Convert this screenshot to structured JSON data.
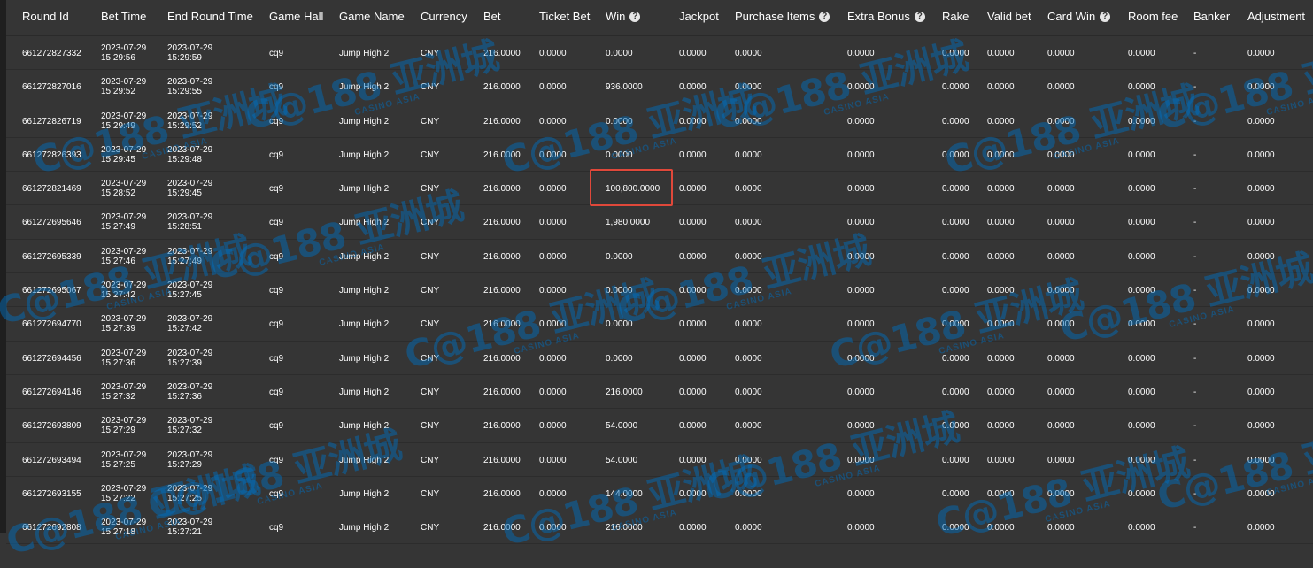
{
  "columns": [
    {
      "label": "Round Id",
      "help": ""
    },
    {
      "label": "Bet Time",
      "help": ""
    },
    {
      "label": "End Round Time",
      "help": ""
    },
    {
      "label": "Game Hall",
      "help": ""
    },
    {
      "label": "Game Name",
      "help": ""
    },
    {
      "label": "Currency",
      "help": ""
    },
    {
      "label": "Bet",
      "help": ""
    },
    {
      "label": "Ticket Bet",
      "help": ""
    },
    {
      "label": "Win",
      "help": "?"
    },
    {
      "label": "Jackpot",
      "help": ""
    },
    {
      "label": "Purchase Items",
      "help": "?"
    },
    {
      "label": "Extra Bonus",
      "help": "?"
    },
    {
      "label": "Rake",
      "help": ""
    },
    {
      "label": "Valid bet",
      "help": ""
    },
    {
      "label": "Card Win",
      "help": "?"
    },
    {
      "label": "Room fee",
      "help": ""
    },
    {
      "label": "Banker",
      "help": ""
    },
    {
      "label": "Adjustment",
      "help": ""
    }
  ],
  "rows": [
    {
      "round_id": "661272827332",
      "bet_date": "2023-07-29",
      "bet_time": "15:29:56",
      "end_date": "2023-07-29",
      "end_time": "15:29:59",
      "hall": "cq9",
      "game": "Jump High 2",
      "currency": "CNY",
      "bet": "216.0000",
      "ticket_bet": "0.0000",
      "win": "0.0000",
      "jackpot": "0.0000",
      "purchase": "0.0000",
      "extra": "0.0000",
      "rake": "0.0000",
      "valid": "0.0000",
      "card_win": "0.0000",
      "room_fee": "0.0000",
      "banker": "-",
      "adjustment": "0.0000"
    },
    {
      "round_id": "661272827016",
      "bet_date": "2023-07-29",
      "bet_time": "15:29:52",
      "end_date": "2023-07-29",
      "end_time": "15:29:55",
      "hall": "cq9",
      "game": "Jump High 2",
      "currency": "CNY",
      "bet": "216.0000",
      "ticket_bet": "0.0000",
      "win": "936.0000",
      "jackpot": "0.0000",
      "purchase": "0.0000",
      "extra": "0.0000",
      "rake": "0.0000",
      "valid": "0.0000",
      "card_win": "0.0000",
      "room_fee": "0.0000",
      "banker": "-",
      "adjustment": "0.0000"
    },
    {
      "round_id": "661272826719",
      "bet_date": "2023-07-29",
      "bet_time": "15:29:49",
      "end_date": "2023-07-29",
      "end_time": "15:29:52",
      "hall": "cq9",
      "game": "Jump High 2",
      "currency": "CNY",
      "bet": "216.0000",
      "ticket_bet": "0.0000",
      "win": "0.0000",
      "jackpot": "0.0000",
      "purchase": "0.0000",
      "extra": "0.0000",
      "rake": "0.0000",
      "valid": "0.0000",
      "card_win": "0.0000",
      "room_fee": "0.0000",
      "banker": "-",
      "adjustment": "0.0000"
    },
    {
      "round_id": "661272826393",
      "bet_date": "2023-07-29",
      "bet_time": "15:29:45",
      "end_date": "2023-07-29",
      "end_time": "15:29:48",
      "hall": "cq9",
      "game": "Jump High 2",
      "currency": "CNY",
      "bet": "216.0000",
      "ticket_bet": "0.0000",
      "win": "0.0000",
      "jackpot": "0.0000",
      "purchase": "0.0000",
      "extra": "0.0000",
      "rake": "0.0000",
      "valid": "0.0000",
      "card_win": "0.0000",
      "room_fee": "0.0000",
      "banker": "-",
      "adjustment": "0.0000"
    },
    {
      "round_id": "661272821469",
      "bet_date": "2023-07-29",
      "bet_time": "15:28:52",
      "end_date": "2023-07-29",
      "end_time": "15:29:45",
      "hall": "cq9",
      "game": "Jump High 2",
      "currency": "CNY",
      "bet": "216.0000",
      "ticket_bet": "0.0000",
      "win": "100,800.0000",
      "jackpot": "0.0000",
      "purchase": "0.0000",
      "extra": "0.0000",
      "rake": "0.0000",
      "valid": "0.0000",
      "card_win": "0.0000",
      "room_fee": "0.0000",
      "banker": "-",
      "adjustment": "0.0000"
    },
    {
      "round_id": "661272695646",
      "bet_date": "2023-07-29",
      "bet_time": "15:27:49",
      "end_date": "2023-07-29",
      "end_time": "15:28:51",
      "hall": "cq9",
      "game": "Jump High 2",
      "currency": "CNY",
      "bet": "216.0000",
      "ticket_bet": "0.0000",
      "win": "1,980.0000",
      "jackpot": "0.0000",
      "purchase": "0.0000",
      "extra": "0.0000",
      "rake": "0.0000",
      "valid": "0.0000",
      "card_win": "0.0000",
      "room_fee": "0.0000",
      "banker": "-",
      "adjustment": "0.0000"
    },
    {
      "round_id": "661272695339",
      "bet_date": "2023-07-29",
      "bet_time": "15:27:46",
      "end_date": "2023-07-29",
      "end_time": "15:27:49",
      "hall": "cq9",
      "game": "Jump High 2",
      "currency": "CNY",
      "bet": "216.0000",
      "ticket_bet": "0.0000",
      "win": "0.0000",
      "jackpot": "0.0000",
      "purchase": "0.0000",
      "extra": "0.0000",
      "rake": "0.0000",
      "valid": "0.0000",
      "card_win": "0.0000",
      "room_fee": "0.0000",
      "banker": "-",
      "adjustment": "0.0000"
    },
    {
      "round_id": "661272695067",
      "bet_date": "2023-07-29",
      "bet_time": "15:27:42",
      "end_date": "2023-07-29",
      "end_time": "15:27:45",
      "hall": "cq9",
      "game": "Jump High 2",
      "currency": "CNY",
      "bet": "216.0000",
      "ticket_bet": "0.0000",
      "win": "0.0000",
      "jackpot": "0.0000",
      "purchase": "0.0000",
      "extra": "0.0000",
      "rake": "0.0000",
      "valid": "0.0000",
      "card_win": "0.0000",
      "room_fee": "0.0000",
      "banker": "-",
      "adjustment": "0.0000"
    },
    {
      "round_id": "661272694770",
      "bet_date": "2023-07-29",
      "bet_time": "15:27:39",
      "end_date": "2023-07-29",
      "end_time": "15:27:42",
      "hall": "cq9",
      "game": "Jump High 2",
      "currency": "CNY",
      "bet": "216.0000",
      "ticket_bet": "0.0000",
      "win": "0.0000",
      "jackpot": "0.0000",
      "purchase": "0.0000",
      "extra": "0.0000",
      "rake": "0.0000",
      "valid": "0.0000",
      "card_win": "0.0000",
      "room_fee": "0.0000",
      "banker": "-",
      "adjustment": "0.0000"
    },
    {
      "round_id": "661272694456",
      "bet_date": "2023-07-29",
      "bet_time": "15:27:36",
      "end_date": "2023-07-29",
      "end_time": "15:27:39",
      "hall": "cq9",
      "game": "Jump High 2",
      "currency": "CNY",
      "bet": "216.0000",
      "ticket_bet": "0.0000",
      "win": "0.0000",
      "jackpot": "0.0000",
      "purchase": "0.0000",
      "extra": "0.0000",
      "rake": "0.0000",
      "valid": "0.0000",
      "card_win": "0.0000",
      "room_fee": "0.0000",
      "banker": "-",
      "adjustment": "0.0000"
    },
    {
      "round_id": "661272694146",
      "bet_date": "2023-07-29",
      "bet_time": "15:27:32",
      "end_date": "2023-07-29",
      "end_time": "15:27:36",
      "hall": "cq9",
      "game": "Jump High 2",
      "currency": "CNY",
      "bet": "216.0000",
      "ticket_bet": "0.0000",
      "win": "216.0000",
      "jackpot": "0.0000",
      "purchase": "0.0000",
      "extra": "0.0000",
      "rake": "0.0000",
      "valid": "0.0000",
      "card_win": "0.0000",
      "room_fee": "0.0000",
      "banker": "-",
      "adjustment": "0.0000"
    },
    {
      "round_id": "661272693809",
      "bet_date": "2023-07-29",
      "bet_time": "15:27:29",
      "end_date": "2023-07-29",
      "end_time": "15:27:32",
      "hall": "cq9",
      "game": "Jump High 2",
      "currency": "CNY",
      "bet": "216.0000",
      "ticket_bet": "0.0000",
      "win": "54.0000",
      "jackpot": "0.0000",
      "purchase": "0.0000",
      "extra": "0.0000",
      "rake": "0.0000",
      "valid": "0.0000",
      "card_win": "0.0000",
      "room_fee": "0.0000",
      "banker": "-",
      "adjustment": "0.0000"
    },
    {
      "round_id": "661272693494",
      "bet_date": "2023-07-29",
      "bet_time": "15:27:25",
      "end_date": "2023-07-29",
      "end_time": "15:27:29",
      "hall": "cq9",
      "game": "Jump High 2",
      "currency": "CNY",
      "bet": "216.0000",
      "ticket_bet": "0.0000",
      "win": "54.0000",
      "jackpot": "0.0000",
      "purchase": "0.0000",
      "extra": "0.0000",
      "rake": "0.0000",
      "valid": "0.0000",
      "card_win": "0.0000",
      "room_fee": "0.0000",
      "banker": "-",
      "adjustment": "0.0000"
    },
    {
      "round_id": "661272693155",
      "bet_date": "2023-07-29",
      "bet_time": "15:27:22",
      "end_date": "2023-07-29",
      "end_time": "15:27:25",
      "hall": "cq9",
      "game": "Jump High 2",
      "currency": "CNY",
      "bet": "216.0000",
      "ticket_bet": "0.0000",
      "win": "144.0000",
      "jackpot": "0.0000",
      "purchase": "0.0000",
      "extra": "0.0000",
      "rake": "0.0000",
      "valid": "0.0000",
      "card_win": "0.0000",
      "room_fee": "0.0000",
      "banker": "-",
      "adjustment": "0.0000"
    },
    {
      "round_id": "661272692808",
      "bet_date": "2023-07-29",
      "bet_time": "15:27:18",
      "end_date": "2023-07-29",
      "end_time": "15:27:21",
      "hall": "cq9",
      "game": "Jump High 2",
      "currency": "CNY",
      "bet": "216.0000",
      "ticket_bet": "0.0000",
      "win": "216.0000",
      "jackpot": "0.0000",
      "purchase": "0.0000",
      "extra": "0.0000",
      "rake": "0.0000",
      "valid": "0.0000",
      "card_win": "0.0000",
      "room_fee": "0.0000",
      "banker": "-",
      "adjustment": "0.0000"
    }
  ],
  "watermark": {
    "brand": "C@188 亚洲城",
    "sub": "CASINO ASIA"
  },
  "colors": {
    "background": "#353535",
    "highlight_border": "#e0483a",
    "watermark": "#006ebe"
  }
}
